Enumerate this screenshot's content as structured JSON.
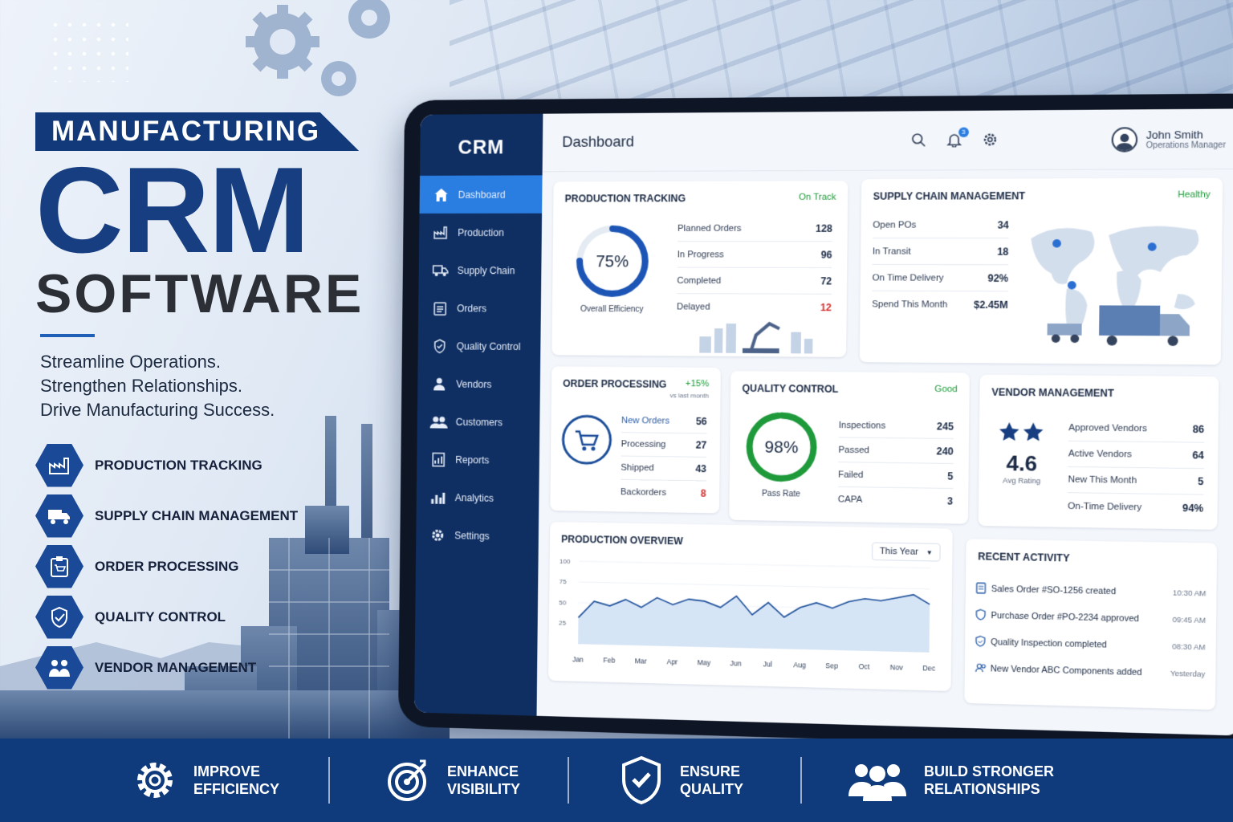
{
  "promo": {
    "banner": "MANUFACTURING",
    "headline": "CRM",
    "subheadline": "SOFTWARE",
    "tagline": [
      "Streamline Operations.",
      "Strengthen Relationships.",
      "Drive Manufacturing Success."
    ],
    "features": [
      {
        "label": "PRODUCTION TRACKING",
        "icon": "factory-icon"
      },
      {
        "label": "SUPPLY CHAIN MANAGEMENT",
        "icon": "truck-icon"
      },
      {
        "label": "ORDER PROCESSING",
        "icon": "clipboard-cart-icon"
      },
      {
        "label": "QUALITY CONTROL",
        "icon": "shield-check-icon"
      },
      {
        "label": "VENDOR MANAGEMENT",
        "icon": "handshake-icon"
      }
    ]
  },
  "app": {
    "brand": "CRM",
    "page_title": "Dashboard",
    "notification_count": "3",
    "user": {
      "name": "John Smith",
      "role": "Operations Manager"
    },
    "nav": [
      {
        "label": "Dashboard",
        "icon": "home-icon",
        "active": true
      },
      {
        "label": "Production",
        "icon": "factory-icon"
      },
      {
        "label": "Supply Chain",
        "icon": "truck-icon"
      },
      {
        "label": "Orders",
        "icon": "clipboard-icon"
      },
      {
        "label": "Quality Control",
        "icon": "shield-check-icon"
      },
      {
        "label": "Vendors",
        "icon": "vendor-icon"
      },
      {
        "label": "Customers",
        "icon": "users-icon"
      },
      {
        "label": "Reports",
        "icon": "report-icon"
      },
      {
        "label": "Analytics",
        "icon": "bar-chart-icon"
      },
      {
        "label": "Settings",
        "icon": "gear-icon"
      }
    ]
  },
  "production_tracking": {
    "title": "PRODUCTION TRACKING",
    "status": "On Track",
    "efficiency": "75%",
    "efficiency_value": 75,
    "efficiency_label": "Overall Efficiency",
    "rows": [
      {
        "label": "Planned Orders",
        "value": "128"
      },
      {
        "label": "In Progress",
        "value": "96"
      },
      {
        "label": "Completed",
        "value": "72"
      },
      {
        "label": "Delayed",
        "value": "12"
      }
    ]
  },
  "supply_chain": {
    "title": "SUPPLY CHAIN MANAGEMENT",
    "status": "Healthy",
    "rows": [
      {
        "label": "Open POs",
        "value": "34"
      },
      {
        "label": "In Transit",
        "value": "18"
      },
      {
        "label": "On Time Delivery",
        "value": "92%"
      },
      {
        "label": "Spend This Month",
        "value": "$2.45M"
      }
    ]
  },
  "order_processing": {
    "title": "ORDER PROCESSING",
    "status": "+15%",
    "status_sub": "vs last month",
    "rows": [
      {
        "label": "New Orders",
        "value": "56"
      },
      {
        "label": "Processing",
        "value": "27"
      },
      {
        "label": "Shipped",
        "value": "43"
      },
      {
        "label": "Backorders",
        "value": "8"
      }
    ]
  },
  "quality_control": {
    "title": "QUALITY CONTROL",
    "status": "Good",
    "pass_rate": "98%",
    "pass_rate_value": 98,
    "pass_rate_label": "Pass Rate",
    "rows": [
      {
        "label": "Inspections",
        "value": "245"
      },
      {
        "label": "Passed",
        "value": "240"
      },
      {
        "label": "Failed",
        "value": "5"
      },
      {
        "label": "CAPA",
        "value": "3"
      }
    ]
  },
  "vendor_management": {
    "title": "VENDOR MANAGEMENT",
    "rating": "4.6",
    "rating_label": "Avg Rating",
    "stars_filled": 2,
    "rows": [
      {
        "label": "Approved Vendors",
        "value": "86"
      },
      {
        "label": "Active Vendors",
        "value": "64"
      },
      {
        "label": "New This Month",
        "value": "5"
      },
      {
        "label": "On-Time Delivery",
        "value": "94%"
      }
    ]
  },
  "production_overview": {
    "title": "PRODUCTION OVERVIEW",
    "period": "This Year"
  },
  "chart_data": {
    "type": "area",
    "title": "PRODUCTION OVERVIEW",
    "categories": [
      "Jan",
      "Feb",
      "Mar",
      "Apr",
      "May",
      "Jun",
      "Jul",
      "Aug",
      "Sep",
      "Oct",
      "Nov",
      "Dec"
    ],
    "yticks": [
      "100",
      "75",
      "50",
      "25"
    ],
    "ylim": [
      0,
      100
    ],
    "series": [
      {
        "x": [
          0,
          0.5,
          1,
          1.5,
          2,
          2.5,
          3,
          3.5,
          4,
          4.5,
          5,
          5.5,
          6,
          6.5,
          7,
          7.5,
          8,
          8.5,
          9,
          9.5,
          10,
          10.5,
          11
        ],
        "values": [
          32,
          52,
          47,
          55,
          46,
          58,
          50,
          57,
          55,
          48,
          62,
          40,
          55,
          38,
          50,
          56,
          50,
          58,
          62,
          60,
          64,
          68,
          57
        ]
      }
    ],
    "grid": true
  },
  "recent_activity": {
    "title": "RECENT ACTIVITY",
    "items": [
      {
        "text": "Sales Order #SO-1256 created",
        "time": "10:30 AM"
      },
      {
        "text": "Purchase Order #PO-2234 approved",
        "time": "09:45 AM"
      },
      {
        "text": "Quality Inspection completed",
        "time": "08:30 AM"
      },
      {
        "text": "New Vendor ABC Components added",
        "time": "Yesterday"
      }
    ]
  },
  "benefits": [
    {
      "line1": "IMPROVE",
      "line2": "EFFICIENCY",
      "icon": "gear-icon"
    },
    {
      "line1": "ENHANCE",
      "line2": "VISIBILITY",
      "icon": "target-icon"
    },
    {
      "line1": "ENSURE",
      "line2": "QUALITY",
      "icon": "shield-check-icon"
    },
    {
      "line1": "BUILD STRONGER",
      "line2": "RELATIONSHIPS",
      "icon": "users-icon"
    }
  ],
  "colors": {
    "brand_navy": "#0f2f63",
    "accent_blue": "#2a7de1",
    "success_green": "#1f9a3b",
    "danger_red": "#d32f2f"
  }
}
